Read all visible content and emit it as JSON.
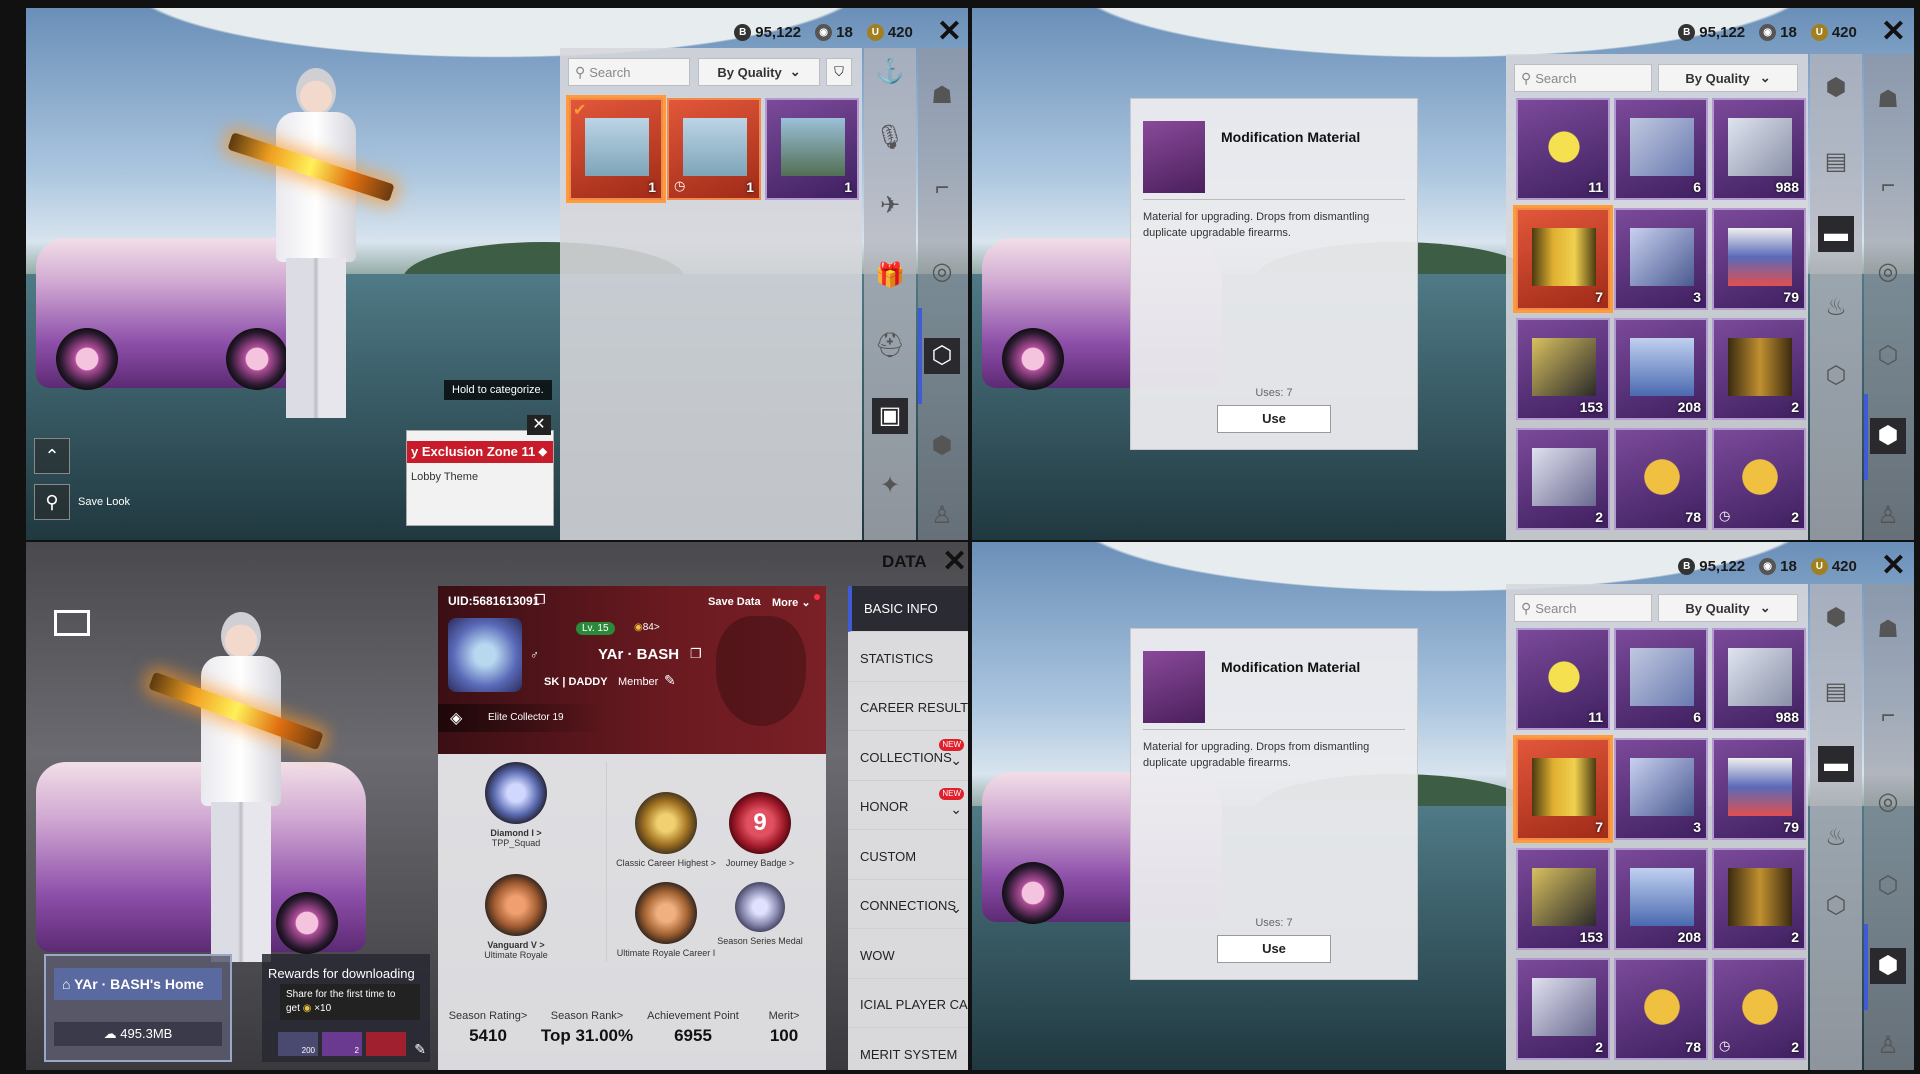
{
  "currency": {
    "bp": "95,122",
    "silver": "18",
    "uc": "420"
  },
  "colors": {
    "accent": "#3f5bd6",
    "tile_purple": "#5c2f80",
    "tile_orange": "#d04a2c",
    "close": "#111111"
  },
  "q1": {
    "search_placeholder": "Search",
    "sort_label": "By Quality",
    "tiles": [
      {
        "count": "1"
      },
      {
        "count": "1"
      },
      {
        "count": "1"
      }
    ],
    "tooltip": "Hold to categorize.",
    "theme_name": "y Exclusion Zone 11",
    "theme_type": "Lobby Theme",
    "save_look": "Save Look"
  },
  "q2": {
    "search_placeholder": "Search",
    "sort_label": "By Quality",
    "detail_title": "Modification Material",
    "detail_desc": "Material for upgrading. Drops from dismantling duplicate upgradable firearms.",
    "uses": "Uses: 7",
    "use_btn": "Use",
    "tiles": [
      {
        "count": "11"
      },
      {
        "count": "6"
      },
      {
        "count": "988"
      },
      {
        "count": "7"
      },
      {
        "count": "3"
      },
      {
        "count": "79"
      },
      {
        "count": "153"
      },
      {
        "count": "208"
      },
      {
        "count": "2"
      },
      {
        "count": "2"
      },
      {
        "count": "78"
      },
      {
        "count": "2"
      }
    ]
  },
  "q3": {
    "title": "DATA",
    "uid": "UID:5681613091",
    "save_data": "Save Data",
    "more": "More",
    "level": "Lv. 15",
    "popularity": "84",
    "player_name": "YAr · BASH",
    "clan": "SK | DADDY",
    "clan_role": "Member",
    "collector": "Elite Collector 19",
    "badges": [
      {
        "label": "Diamond I >",
        "sub": "TPP_Squad"
      },
      {
        "label": "Classic Career Highest >",
        "sub": ""
      },
      {
        "label": "Journey Badge >",
        "sub": ""
      },
      {
        "label": "Vanguard V >",
        "sub": "Ultimate Royale"
      },
      {
        "label": "Ultimate Royale Career I",
        "sub": ""
      },
      {
        "label": "Season Series Medal",
        "sub": ""
      }
    ],
    "journey_num": "9",
    "stats": [
      {
        "label": "Season Rating>",
        "value": "5410"
      },
      {
        "label": "Season Rank>",
        "value": "Top 31.00%"
      },
      {
        "label": "Achievement Point",
        "value": "6955"
      },
      {
        "label": "Merit>",
        "value": "100"
      }
    ],
    "nav": [
      {
        "label": "BASIC INFO"
      },
      {
        "label": "STATISTICS"
      },
      {
        "label": "CAREER RESULTS"
      },
      {
        "label": "COLLECTIONS",
        "badge": "NEW"
      },
      {
        "label": "HONOR",
        "badge": "NEW"
      },
      {
        "label": "CUSTOM"
      },
      {
        "label": "CONNECTIONS"
      },
      {
        "label": "WOW"
      },
      {
        "label": "ICIAL PLAYER CARD"
      },
      {
        "label": "MERIT SYSTEM"
      }
    ],
    "home_name": "YAr · BASH's Home",
    "home_size": "495.3MB",
    "rewards": "Rewards for downloading",
    "share_tip_1": "Share for the first time to",
    "share_tip_2": "get",
    "share_tip_3": "×10",
    "share_count_1": "200",
    "share_count_2": "2"
  },
  "q4": {
    "search_placeholder": "Search",
    "sort_label": "By Quality",
    "detail_title": "Modification Material",
    "detail_desc": "Material for upgrading. Drops from dismantling duplicate upgradable firearms.",
    "uses": "Uses: 7",
    "use_btn": "Use",
    "tiles": [
      {
        "count": "11"
      },
      {
        "count": "6"
      },
      {
        "count": "988"
      },
      {
        "count": "7"
      },
      {
        "count": "3"
      },
      {
        "count": "79"
      },
      {
        "count": "153"
      },
      {
        "count": "208"
      },
      {
        "count": "2"
      },
      {
        "count": "2"
      },
      {
        "count": "78"
      },
      {
        "count": "2"
      }
    ]
  }
}
